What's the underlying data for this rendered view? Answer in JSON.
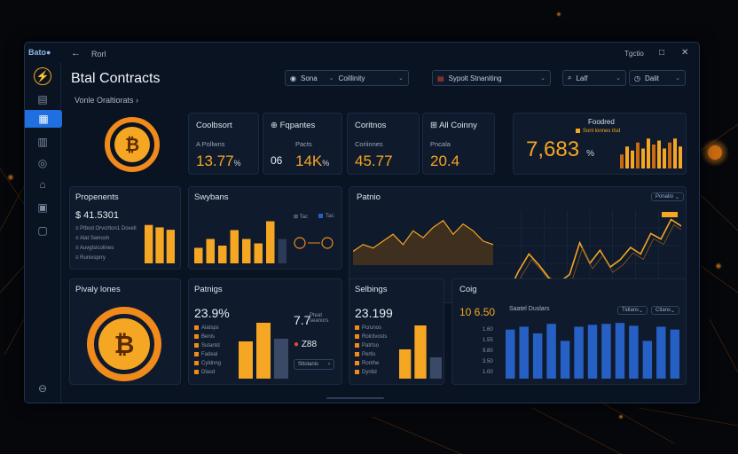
{
  "window": {
    "logo": "Bato●",
    "title": "Rorl",
    "back": "←"
  },
  "sidebar": {
    "items": [
      {
        "icon": "bolt-icon",
        "glyph": "⚡"
      },
      {
        "icon": "document-icon",
        "glyph": "▤"
      },
      {
        "icon": "contracts-icon",
        "glyph": "▦"
      },
      {
        "icon": "building-icon",
        "glyph": "▥"
      },
      {
        "icon": "globe-icon",
        "glyph": "◎"
      },
      {
        "icon": "home-icon",
        "glyph": "⌂"
      },
      {
        "icon": "ledger-icon",
        "glyph": "▣"
      },
      {
        "icon": "lock-icon",
        "glyph": "▢"
      },
      {
        "icon": "settings-icon",
        "glyph": "⊖"
      }
    ]
  },
  "header": {
    "title": "Btal Contracts",
    "subtitle": "Vonle Oraltiorats ›",
    "dropdowns": [
      {
        "label": "Sona",
        "value": "Coillinity"
      },
      {
        "label": "Sypolt Stnaniting"
      },
      {
        "label": "Lalf"
      },
      {
        "label": "Dalit"
      }
    ],
    "controls": [
      "Tgctio",
      "□",
      "✕"
    ]
  },
  "stats": [
    {
      "title": "Coolbsort",
      "label": "A Pollwns",
      "value": "13.77",
      "unit": "%"
    },
    {
      "title": "Fqpantes",
      "label": "Pacts",
      "value": "14K",
      "unit": "%",
      "prefix": "06"
    },
    {
      "title": "Coritnos",
      "label": "Coriinnes",
      "value": "45.77"
    },
    {
      "title": "All Coinny",
      "label": "Pncala",
      "value": "20.4"
    }
  ],
  "featured": {
    "title": "Foodred",
    "sub": "Sonl lonnes itsd",
    "value": "7,683",
    "unit": "%"
  },
  "panels": {
    "proponents": {
      "title": "Propenents",
      "value": "$ 41.5301",
      "rows": [
        "Ptbod Orvcrtlon1 Dovell",
        "Alat Swnosh",
        "Auvgtslcolines",
        "Runivsprry"
      ]
    },
    "swybans": {
      "title": "Swybans",
      "legend": [
        "Tac",
        "Tas"
      ]
    },
    "patnio": {
      "title": "Patnio",
      "filter": "Ponalio"
    },
    "heavy": {
      "title": "Pivaly lones"
    },
    "patings": {
      "title": "Patnigs",
      "value": "23.9%",
      "value2": "7.7",
      "value2_note": "Pteat seanors",
      "value3": "Z88",
      "rows": [
        "Alatsps",
        "Benis",
        "Sutantd",
        "Fadeal",
        "Cyldnng",
        "Dlasd"
      ],
      "button": "Sttolanis"
    },
    "selbings": {
      "title": "Selbings",
      "value": "23.199",
      "rows": [
        "Pcrunos",
        "Roirdvosts",
        "Patrtso",
        "Pertis",
        "Ronthe",
        "Dynlid"
      ]
    },
    "coig": {
      "title": "Coig",
      "value": "10 6.50",
      "chart_title": "Saatel Duslars",
      "pills": [
        "Tidlans",
        "Ctlans"
      ],
      "yticks": [
        "1.60",
        "1.55",
        "9.80",
        "3.50",
        "1.00"
      ]
    }
  },
  "chart_data": [
    {
      "type": "bar",
      "title": "Propenents",
      "values": [
        32,
        30,
        28
      ],
      "color": "#f5a623"
    },
    {
      "type": "bar",
      "title": "Swybans",
      "values": [
        14,
        22,
        16,
        30,
        22,
        18,
        38,
        22
      ],
      "color": "#f5a623"
    },
    {
      "type": "area",
      "title": "Patnio",
      "values": [
        8,
        12,
        10,
        14,
        18,
        12,
        20,
        16,
        22,
        26,
        18,
        24,
        20,
        14,
        12
      ]
    },
    {
      "type": "line",
      "title": "Patnio",
      "values": [
        4,
        8,
        30,
        48,
        36,
        22,
        18,
        26,
        60,
        38,
        52,
        34,
        42,
        55,
        48,
        70,
        64,
        85,
        78
      ]
    },
    {
      "type": "bar",
      "title": "Patnigs",
      "values": [
        28,
        42,
        30
      ]
    },
    {
      "type": "bar",
      "title": "Selbings",
      "values": [
        22,
        40,
        16
      ]
    },
    {
      "type": "bar",
      "title": "Saatel Duslars",
      "values": [
        52,
        55,
        48,
        58,
        40,
        55,
        57,
        58,
        59,
        56,
        40,
        55,
        52
      ],
      "color": "#2660c4"
    },
    {
      "type": "bar",
      "title": "Foodred",
      "values": [
        14,
        22,
        18,
        26,
        20,
        30,
        24,
        28,
        20,
        26,
        30,
        22
      ]
    }
  ],
  "colors": {
    "accent": "#f5a623",
    "blue": "#2660c4",
    "sidebar_active": "#1f6fe0"
  }
}
